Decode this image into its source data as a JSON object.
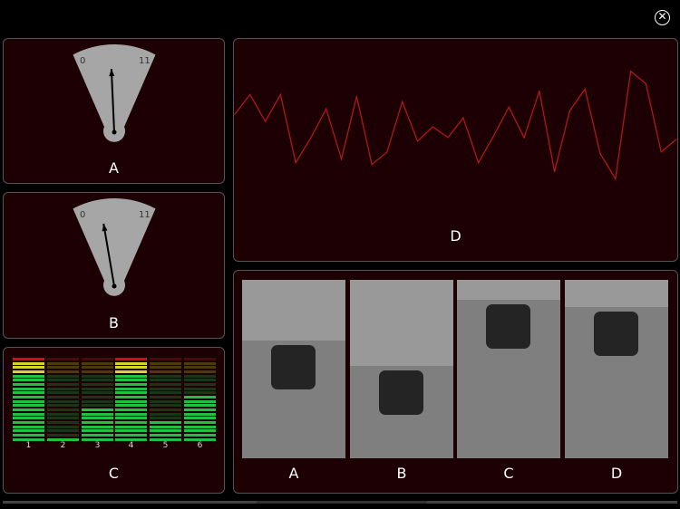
{
  "close_icon": "close-circle-icon",
  "gauges": [
    {
      "label": "A",
      "min_label": "0",
      "max_label": "11",
      "value": 5.0,
      "max": 11
    },
    {
      "label": "B",
      "min_label": "0",
      "max_label": "11",
      "value": 3.6,
      "max": 11
    }
  ],
  "meters": {
    "label": "C",
    "segments": 20,
    "channels": [
      {
        "name": "1",
        "level": 20
      },
      {
        "name": "2",
        "level": 1
      },
      {
        "name": "3",
        "level": 8
      },
      {
        "name": "4",
        "level": 20
      },
      {
        "name": "5",
        "level": 5
      },
      {
        "name": "6",
        "level": 11
      }
    ],
    "colors": {
      "green": "#22c040",
      "yellow": "#d4d42a",
      "red": "#cc1010",
      "green_off": "#1d3418",
      "yellow_off": "#4a3a10",
      "red_off": "#4a0808"
    }
  },
  "chart_data": {
    "type": "line",
    "title": "D",
    "ylim": [
      0,
      100
    ],
    "color": "#b01818",
    "values": [
      58,
      69,
      54,
      69,
      31,
      45,
      61,
      33,
      68,
      30,
      37,
      65,
      43,
      51,
      45,
      56,
      31,
      46,
      62,
      45,
      71,
      26,
      60,
      72,
      36,
      22,
      82,
      75,
      37,
      44
    ]
  },
  "sliders": [
    {
      "label": "A",
      "value": 0.66
    },
    {
      "label": "B",
      "value": 0.52
    },
    {
      "label": "C",
      "value": 0.89
    },
    {
      "label": "D",
      "value": 0.85
    }
  ],
  "scrollbar": {
    "position": 0.38
  }
}
